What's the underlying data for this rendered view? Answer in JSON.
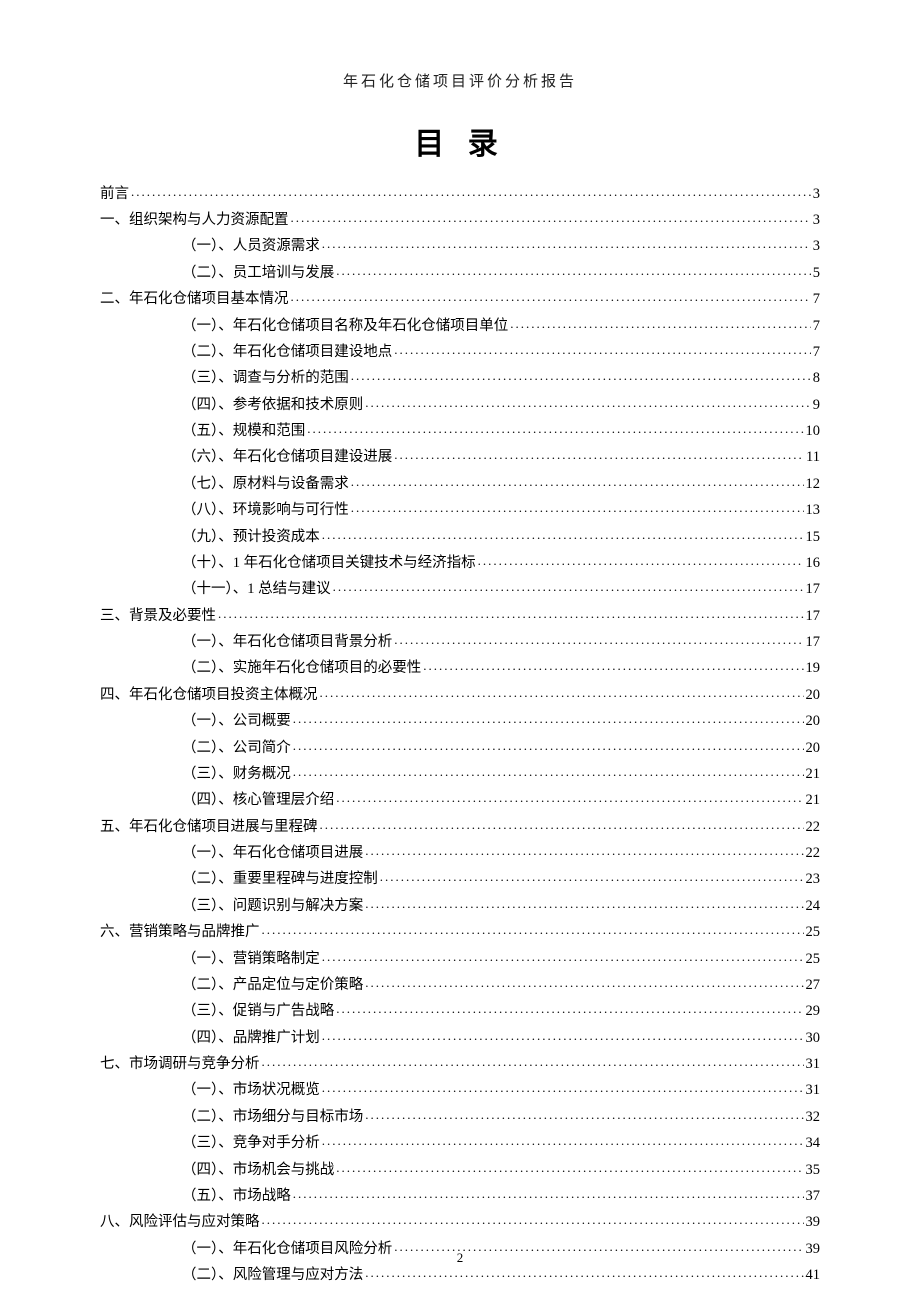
{
  "header": "年石化仓储项目评价分析报告",
  "title": "目 录",
  "page_number": "2",
  "toc": [
    {
      "level": 0,
      "label": "前言",
      "page": "3"
    },
    {
      "level": 0,
      "label": "一、组织架构与人力资源配置",
      "page": "3"
    },
    {
      "level": 1,
      "label": "（一）、人员资源需求",
      "page": "3"
    },
    {
      "level": 1,
      "label": "（二）、员工培训与发展",
      "page": "5"
    },
    {
      "level": 0,
      "label": "二、年石化仓储项目基本情况",
      "page": "7"
    },
    {
      "level": 1,
      "label": "（一）、年石化仓储项目名称及年石化仓储项目单位",
      "page": "7"
    },
    {
      "level": 1,
      "label": "（二）、年石化仓储项目建设地点",
      "page": "7"
    },
    {
      "level": 1,
      "label": "（三）、调查与分析的范围",
      "page": "8"
    },
    {
      "level": 1,
      "label": "（四）、参考依据和技术原则",
      "page": "9"
    },
    {
      "level": 1,
      "label": "（五）、规模和范围",
      "page": "10"
    },
    {
      "level": 1,
      "label": "（六）、年石化仓储项目建设进展",
      "page": "11"
    },
    {
      "level": 1,
      "label": "（七）、原材料与设备需求",
      "page": "12"
    },
    {
      "level": 1,
      "label": "（八）、环境影响与可行性",
      "page": "13"
    },
    {
      "level": 1,
      "label": "（九）、预计投资成本",
      "page": "15"
    },
    {
      "level": 1,
      "label": "（十）、1 年石化仓储项目关键技术与经济指标",
      "page": "16"
    },
    {
      "level": 1,
      "label": "（十一）、1 总结与建议",
      "page": "17"
    },
    {
      "level": 0,
      "label": "三、背景及必要性",
      "page": "17"
    },
    {
      "level": 1,
      "label": "（一）、年石化仓储项目背景分析",
      "page": "17"
    },
    {
      "level": 1,
      "label": "（二）、实施年石化仓储项目的必要性",
      "page": "19"
    },
    {
      "level": 0,
      "label": "四、年石化仓储项目投资主体概况",
      "page": "20"
    },
    {
      "level": 1,
      "label": "（一）、公司概要",
      "page": "20"
    },
    {
      "level": 1,
      "label": "（二）、公司简介",
      "page": "20"
    },
    {
      "level": 1,
      "label": "（三）、财务概况",
      "page": "21"
    },
    {
      "level": 1,
      "label": "（四）、核心管理层介绍",
      "page": "21"
    },
    {
      "level": 0,
      "label": "五、年石化仓储项目进展与里程碑",
      "page": "22"
    },
    {
      "level": 1,
      "label": "（一）、年石化仓储项目进展",
      "page": "22"
    },
    {
      "level": 1,
      "label": "（二）、重要里程碑与进度控制",
      "page": "23"
    },
    {
      "level": 1,
      "label": "（三）、问题识别与解决方案",
      "page": "24"
    },
    {
      "level": 0,
      "label": "六、营销策略与品牌推广",
      "page": "25"
    },
    {
      "level": 1,
      "label": "（一）、营销策略制定",
      "page": "25"
    },
    {
      "level": 1,
      "label": "（二）、产品定位与定价策略",
      "page": "27"
    },
    {
      "level": 1,
      "label": "（三）、促销与广告战略",
      "page": "29"
    },
    {
      "level": 1,
      "label": "（四）、品牌推广计划",
      "page": "30"
    },
    {
      "level": 0,
      "label": "七、市场调研与竞争分析",
      "page": "31"
    },
    {
      "level": 1,
      "label": "（一）、市场状况概览",
      "page": "31"
    },
    {
      "level": 1,
      "label": "（二）、市场细分与目标市场",
      "page": "32"
    },
    {
      "level": 1,
      "label": "（三）、竞争对手分析",
      "page": "34"
    },
    {
      "level": 1,
      "label": "（四）、市场机会与挑战",
      "page": "35"
    },
    {
      "level": 1,
      "label": "（五）、市场战略",
      "page": "37"
    },
    {
      "level": 0,
      "label": "八、风险评估与应对策略",
      "page": "39"
    },
    {
      "level": 1,
      "label": "（一）、年石化仓储项目风险分析",
      "page": "39"
    },
    {
      "level": 1,
      "label": "（二）、风险管理与应对方法",
      "page": "41"
    }
  ]
}
